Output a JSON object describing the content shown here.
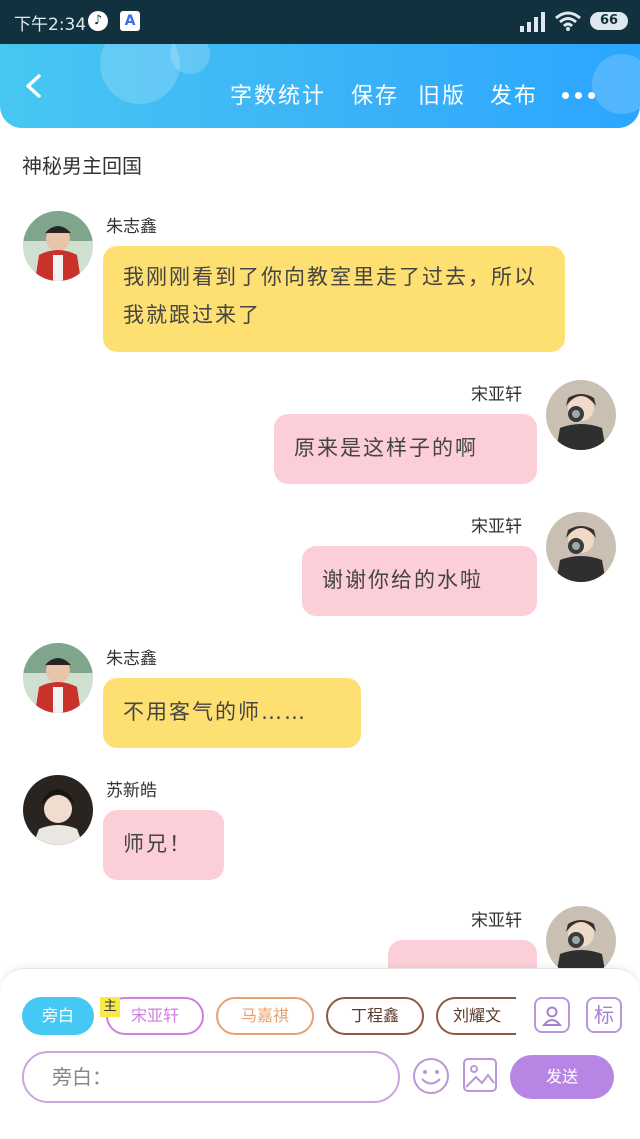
{
  "status_bar": {
    "time": "下午2:34",
    "battery": "66"
  },
  "header": {
    "back_icon": "chevron-left-icon",
    "word_count_label": "字数统计",
    "save_label": "保存",
    "old_version_label": "旧版",
    "publish_label": "发布",
    "more_icon": "more-dots-icon"
  },
  "story": {
    "title": "神秘男主回国"
  },
  "messages": [
    {
      "speaker": "朱志鑫",
      "side": "left",
      "bubble": "yellow",
      "text": "我刚刚看到了你向教室里走了过去，所以我就跟过来了"
    },
    {
      "speaker": "宋亚轩",
      "side": "right",
      "bubble": "pink",
      "text": "原来是这样子的啊"
    },
    {
      "speaker": "宋亚轩",
      "side": "right",
      "bubble": "pink",
      "text": "谢谢你给的水啦"
    },
    {
      "speaker": "朱志鑫",
      "side": "left",
      "bubble": "yellow",
      "text": "不用客气的师……"
    },
    {
      "speaker": "苏新皓",
      "side": "left",
      "bubble": "pink",
      "text": "师兄！"
    },
    {
      "speaker": "宋亚轩",
      "side": "right",
      "bubble": "pink",
      "text": ""
    }
  ],
  "composer": {
    "chips": [
      "旁白",
      "宋亚轩",
      "马嘉祺",
      "丁程鑫",
      "刘耀文"
    ],
    "main_badge": "主",
    "biaoqian_label": "标",
    "input_placeholder": "旁白：",
    "send_label": "发送"
  },
  "colors": {
    "header": "#3ab0f8",
    "yellow_bubble": "#fedf71",
    "pink_bubble": "#fcced8",
    "send": "#b786e4",
    "narration_chip": "#45c8f3"
  }
}
